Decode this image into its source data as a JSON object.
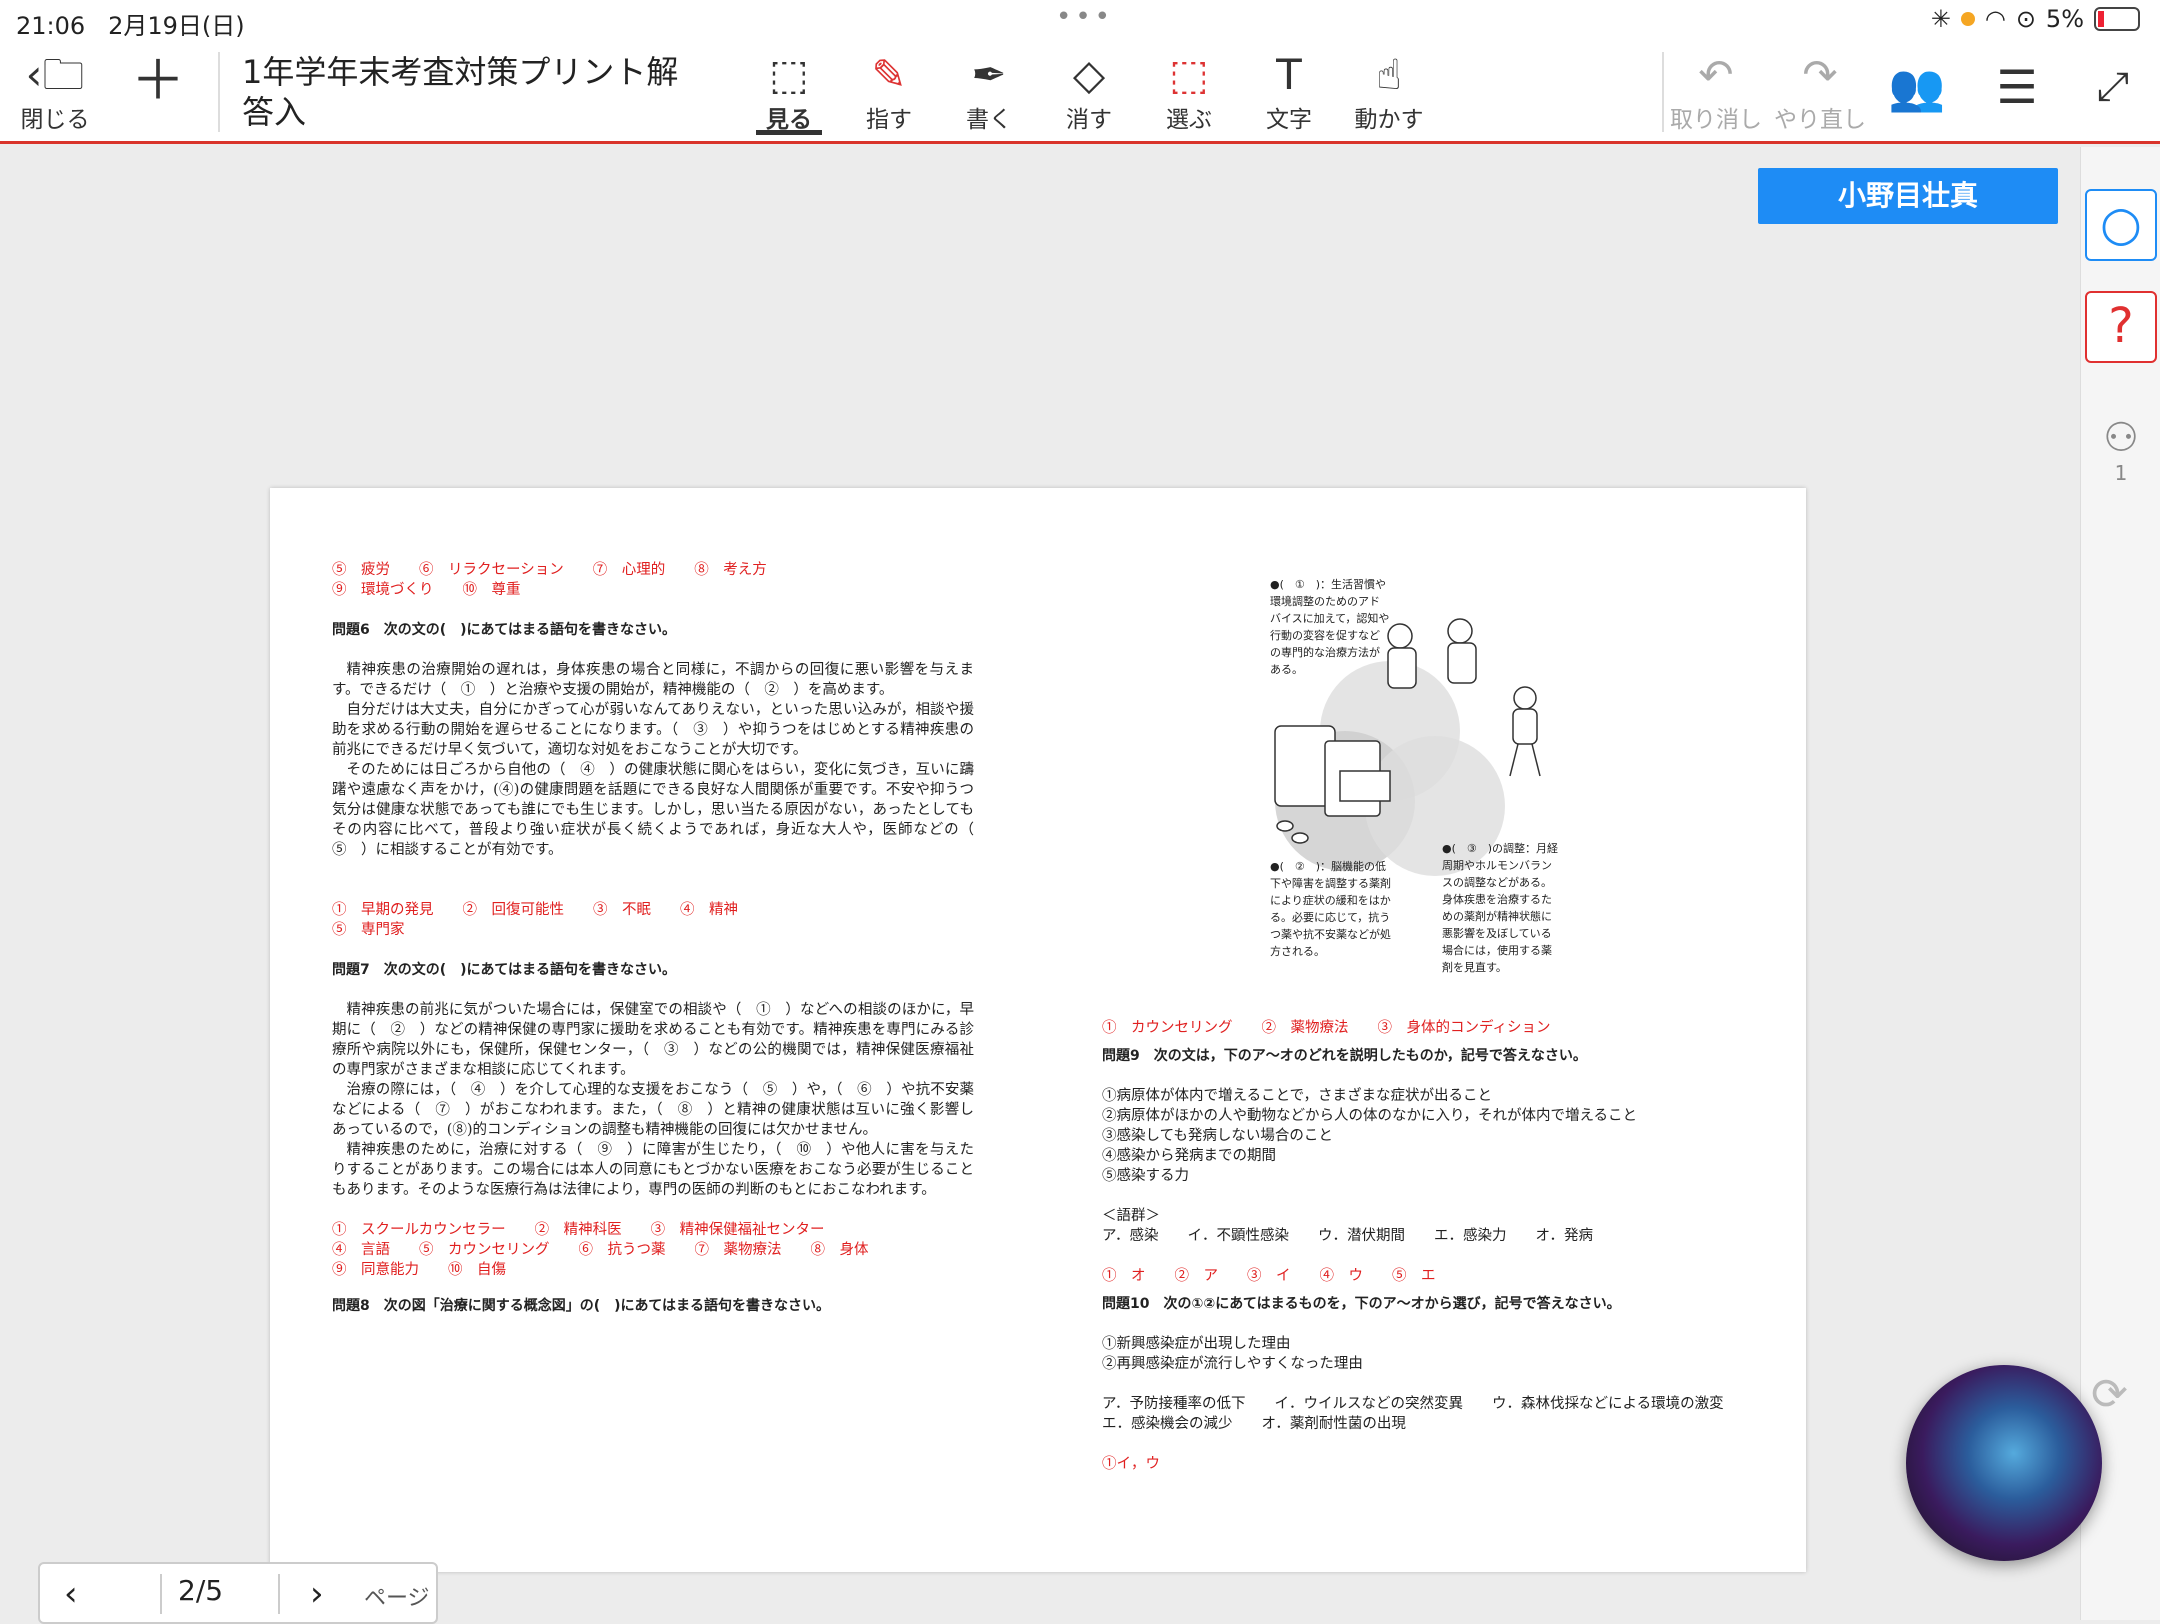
{
  "status": {
    "time": "21:06",
    "date": "2月19日(日)",
    "battery": "5%"
  },
  "toolbar": {
    "close": "閉じる",
    "title": "1年学年末考査対策プリント解答入",
    "tools": [
      {
        "label": "見る"
      },
      {
        "label": "指す"
      },
      {
        "label": "書く"
      },
      {
        "label": "消す"
      },
      {
        "label": "選ぶ"
      },
      {
        "label": "文字"
      },
      {
        "label": "動かす"
      }
    ],
    "undo": "取り消し",
    "redo": "やり直し"
  },
  "user": {
    "name": "小野目壮真"
  },
  "rightbar": {
    "people_count": "1"
  },
  "pager": {
    "current": "2/5",
    "label": "ページ"
  },
  "doc": {
    "left": {
      "ans5_a": "⑤　疲労　　⑥　リラクセーション　　⑦　心理的　　⑧　考え方",
      "ans5_b": "⑨　環境づくり　　⑩　尊重",
      "q6": "問題6　次の文の(　)にあてはまる語句を書きなさい。",
      "q6_p1": "精神疾患の治療開始の遅れは，身体疾患の場合と同様に，不調からの回復に悪い影響を与えます。できるだけ（　①　）と治療や支援の開始が，精神機能の（　②　）を高めます。",
      "q6_p2": "自分だけは大丈夫，自分にかぎって心が弱いなんてありえない，といった思い込みが，相談や援助を求める行動の開始を遅らせることになります。（　③　）や抑うつをはじめとする精神疾患の前兆にできるだけ早く気づいて，適切な対処をおこなうことが大切です。",
      "q6_p3": "そのためには日ごろから自他の（　④　）の健康状態に関心をはらい，変化に気づき，互いに躊躇や遠慮なく声をかけ，(④)の健康問題を話題にできる良好な人間関係が重要です。不安や抑うつ気分は健康な状態であっても誰にでも生じます。しかし，思い当たる原因がない，あったとしてもその内容に比べて，普段より強い症状が長く続くようであれば，身近な大人や，医師などの（　⑤　）に相談することが有効です。",
      "ans6_a": "①　早期の発見　　②　回復可能性　　③　不眠　　④　精神",
      "ans6_b": "⑤　専門家",
      "q7": "問題7　次の文の(　)にあてはまる語句を書きなさい。",
      "q7_p1": "精神疾患の前兆に気がついた場合には，保健室での相談や（　①　）などへの相談のほかに，早期に（　②　）などの精神保健の専門家に援助を求めることも有効です。精神疾患を専門にみる診療所や病院以外にも，保健所，保健センター，（　③　）などの公的機関では，精神保健医療福祉の専門家がさまざまな相談に応じてくれます。",
      "q7_p2": "治療の際には，（　④　）を介して心理的な支援をおこなう（　⑤　）や，（　⑥　）や抗不安薬などによる（　⑦　）がおこなわれます。また，（　⑧　）と精神の健康状態は互いに強く影響しあっているので，(⑧)的コンディションの調整も精神機能の回復には欠かせません。",
      "q7_p3": "精神疾患のために，治療に対する（　⑨　）に障害が生じたり，（　⑩　）や他人に害を与えたりすることがあります。この場合には本人の同意にもとづかない医療をおこなう必要が生じることもあります。そのような医療行為は法律により，専門の医師の判断のもとにおこなわれます。",
      "ans7_a": "①　スクールカウンセラー　　②　精神科医　　③　精神保健福祉センター",
      "ans7_b": "④　言語　　⑤　カウンセリング　　⑥　抗うつ薬　　⑦　薬物療法　　⑧　身体",
      "ans7_c": "⑨　同意能力　　⑩　自傷",
      "q8": "問題8　次の図「治療に関する概念図」の(　)にあてはまる語句を書きなさい。"
    },
    "figure": {
      "t1": "●(　①　)：生活習慣や環境調整のためのアドバイスに加えて，認知や行動の変容を促すなどの専門的な治療方法がある。",
      "t2": "●(　②　)：脳機能の低下や障害を調整する薬剤により症状の緩和をはかる。必要に応じて，抗うつ薬や抗不安薬などが処方される。",
      "t3": "●(　③　)の調整：月経周期やホルモンバランスの調整などがある。身体疾患を治療するための薬剤が精神状態に悪影響を及ぼしている場合には，使用する薬剤を見直す。"
    },
    "right": {
      "ans8": "①　カウンセリング　　②　薬物療法　　③　身体的コンディション",
      "q9": "問題9　次の文は，下のア〜オのどれを説明したものか，記号で答えなさい。",
      "q9_items": [
        "①病原体が体内で増えることで，さまざまな症状が出ること",
        "②病原体がほかの人や動物などから人の体のなかに入り，それが体内で増えること",
        "③感染しても発病しない場合のこと",
        "④感染から発病までの期間",
        "⑤感染する力"
      ],
      "group_label": "＜語群＞",
      "group": "ア．感染　　イ．不顕性感染　　ウ．潜伏期間　　エ．感染力　　オ．発病",
      "ans9": "①　オ　　②　ア　　③　イ　　④　ウ　　⑤　エ",
      "q10": "問題10　次の①②にあてはまるものを，下のア〜オから選び，記号で答えなさい。",
      "q10_items": [
        "①新興感染症が出現した理由",
        "②再興感染症が流行しやすくなった理由"
      ],
      "q10_choices": "ア．予防接種率の低下　　イ．ウイルスなどの突然変異　　ウ．森林伐採などによる環境の激変　　エ．感染機会の減少　　オ．薬剤耐性菌の出現",
      "ans10": "①イ，ウ"
    }
  }
}
